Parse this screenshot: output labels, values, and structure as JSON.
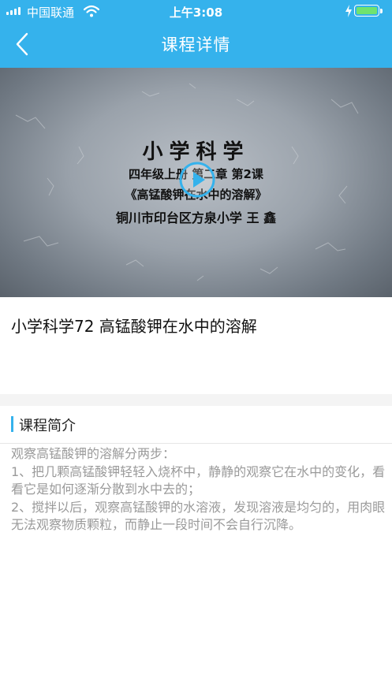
{
  "status_bar": {
    "carrier": "中国联通",
    "time": "上午3:08"
  },
  "nav": {
    "title": "课程详情"
  },
  "video": {
    "title": "小学科学",
    "line1": "四年级上册  第二章  第2课",
    "line2": "《高锰酸钾在水中的溶解》",
    "line3": "铜川市印台区方泉小学  王 鑫"
  },
  "course": {
    "title": "小学科学72 高锰酸钾在水中的溶解"
  },
  "intro": {
    "heading": "课程简介",
    "paragraphs": [
      "观察高锰酸钾的溶解分两步：",
      "1、把几颗高锰酸钾轻轻入烧杯中，静静的观察它在水中的变化，看看它是如何逐渐分散到水中去的；",
      "2、搅拌以后，观察高锰酸钾的水溶液，发现溶液是均匀的，用肉眼无法观察物质颗粒，而静止一段时间不会自行沉降。"
    ]
  },
  "colors": {
    "accent": "#35b2ec",
    "battery": "#6fe36f"
  }
}
